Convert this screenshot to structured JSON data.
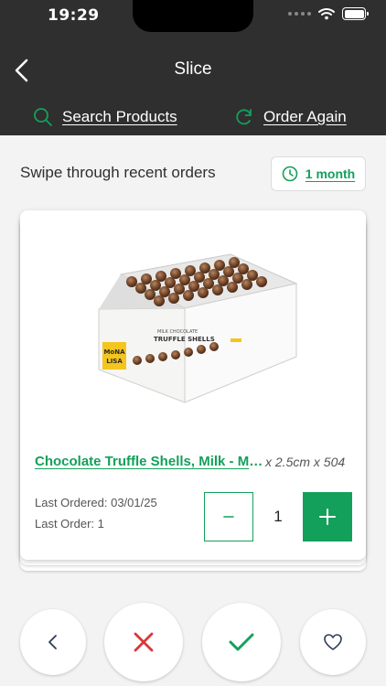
{
  "status_bar": {
    "time": "19:29"
  },
  "header": {
    "title": "Slice",
    "search_label": "Search Products",
    "order_again_label": "Order Again"
  },
  "filter": {
    "label": "Swipe through recent orders",
    "period": "1 month"
  },
  "product": {
    "name": "Chocolate Truffle Shells, Milk - Mona Lisa",
    "size": "x 2.5cm x 504",
    "last_ordered": "Last Ordered: 03/01/25",
    "last_order": "Last Order: 1",
    "quantity": "1",
    "image_brand": "MONA LISA",
    "image_text": "MILK CHOCOLATE TRUFFLE SHELLS"
  },
  "colors": {
    "accent": "#13a05a",
    "header_bg": "#2f2f2f",
    "page_bg": "#f3f3f3",
    "reject": "#d9373a",
    "back_arrow": "#2f3b5a"
  },
  "icons": {
    "back": "chevron-left-icon",
    "search": "search-icon",
    "order_again": "refresh-icon",
    "period": "clock-icon",
    "previous": "chevron-left-icon",
    "reject": "close-icon",
    "accept": "checkmark-icon",
    "favorite": "heart-icon"
  }
}
